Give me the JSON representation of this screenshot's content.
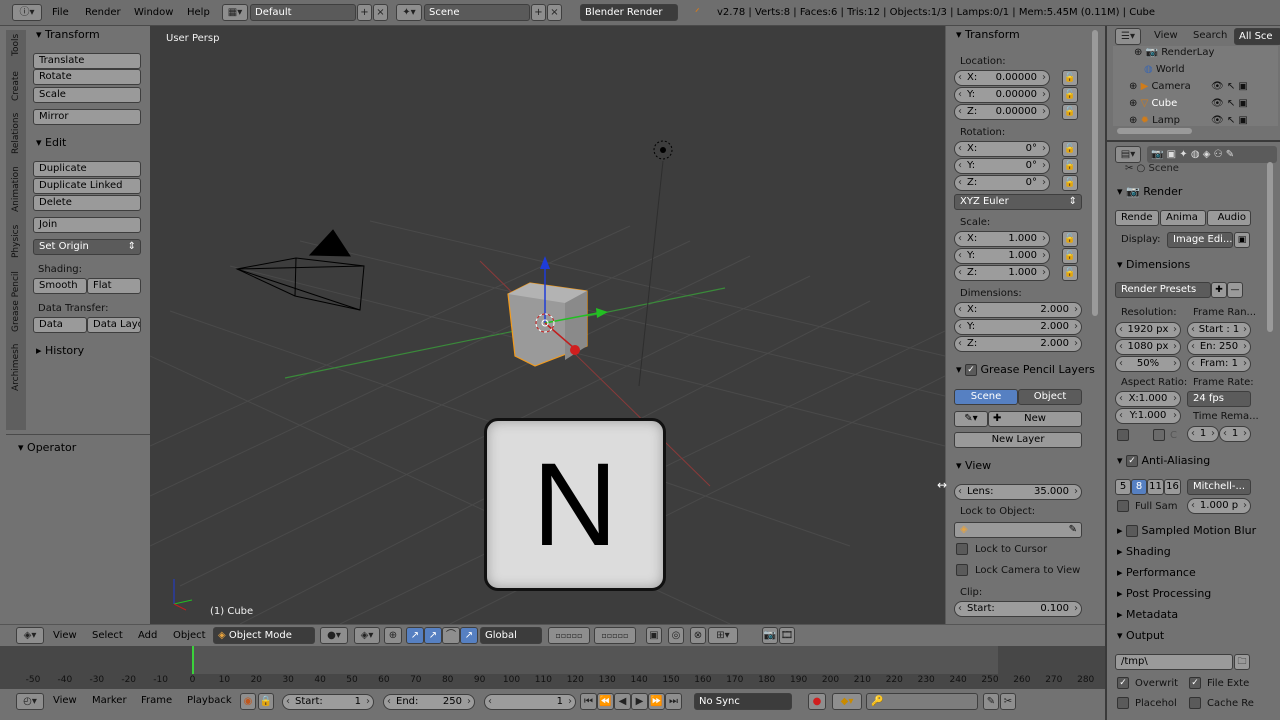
{
  "topbar": {
    "menus": [
      "File",
      "Render",
      "Window",
      "Help"
    ],
    "screen_layout": "Default",
    "scene": "Scene",
    "engine": "Blender Render",
    "stats": "v2.78 | Verts:8 | Faces:6 | Tris:12 | Objects:1/3 | Lamps:0/1 | Mem:5.45M (0.11M) | Cube"
  },
  "toolshelf": {
    "tabs": [
      "Tools",
      "Create",
      "Relations",
      "Animation",
      "Physics",
      "Grease Pencil",
      "Archimesh"
    ],
    "transform_header": "Transform",
    "transform_buttons": [
      "Translate",
      "Rotate",
      "Scale"
    ],
    "mirror": "Mirror",
    "edit_header": "Edit",
    "edit_buttons": [
      "Duplicate",
      "Duplicate Linked",
      "Delete"
    ],
    "join": "Join",
    "set_origin": "Set Origin",
    "shading_label": "Shading:",
    "smooth": "Smooth",
    "flat": "Flat",
    "data_transfer_label": "Data Transfer:",
    "data": "Data",
    "data_layout": "Data Layo",
    "history": "History",
    "operator": "Operator"
  },
  "viewport": {
    "view_name": "User Persp",
    "object_label": "(1) Cube",
    "key_overlay": "N"
  },
  "properties_n": {
    "transform_header": "Transform",
    "location_label": "Location:",
    "location": [
      {
        "k": "X:",
        "v": "0.00000"
      },
      {
        "k": "Y:",
        "v": "0.00000"
      },
      {
        "k": "Z:",
        "v": "0.00000"
      }
    ],
    "rotation_label": "Rotation:",
    "rotation": [
      {
        "k": "X:",
        "v": "0°"
      },
      {
        "k": "Y:",
        "v": "0°"
      },
      {
        "k": "Z:",
        "v": "0°"
      }
    ],
    "rotation_mode": "XYZ Euler",
    "scale_label": "Scale:",
    "scale": [
      {
        "k": "X:",
        "v": "1.000"
      },
      {
        "k": "Y:",
        "v": "1.000"
      },
      {
        "k": "Z:",
        "v": "1.000"
      }
    ],
    "dimensions_label": "Dimensions:",
    "dimensions": [
      {
        "k": "X:",
        "v": "2.000"
      },
      {
        "k": "Y:",
        "v": "2.000"
      },
      {
        "k": "Z:",
        "v": "2.000"
      }
    ],
    "gp_header": "Grease Pencil Layers",
    "gp_scene": "Scene",
    "gp_object": "Object",
    "gp_new": "New",
    "gp_new_layer": "New Layer",
    "view_header": "View",
    "lens_k": "Lens:",
    "lens_v": "35.000",
    "lock_to_object": "Lock to Object:",
    "lock_cursor": "Lock to Cursor",
    "lock_camera": "Lock Camera to View",
    "clip_label": "Clip:",
    "clip_start_k": "Start:",
    "clip_start_v": "0.100"
  },
  "outliner": {
    "view": "View",
    "search": "Search",
    "filter": "All Sce",
    "items": [
      "RenderLay",
      "World",
      "Camera",
      "Cube",
      "Lamp"
    ]
  },
  "render_props": {
    "scene_crumb": "Scene",
    "render_header": "Render",
    "render_buttons": [
      "Rende",
      "Anima",
      "Audio"
    ],
    "display_label": "Display:",
    "display_value": "Image Edi...",
    "dimensions_header": "Dimensions",
    "presets": "Render Presets",
    "resolution_label": "Resolution:",
    "frame_range_label": "Frame Ran...",
    "res_x": "1920 px",
    "res_y": "1080 px",
    "res_pct": "50%",
    "frame_start": "Start : 1",
    "frame_end": "En: 250",
    "frame_step": "Fram: 1",
    "aspect_label": "Aspect Ratio:",
    "framerate_label": "Frame Rate:",
    "aspect_x": "X:1.000",
    "aspect_y": "Y:1.000",
    "fps": "24 fps",
    "time_remap": "Time Rema...",
    "remap_a": "1",
    "remap_b": "1",
    "c_label": "C",
    "aa_header": "Anti-Aliasing",
    "aa_samples": [
      "5",
      "8",
      "11",
      "16"
    ],
    "aa_filter": "Mitchell-...",
    "full_sample": "Full Sam",
    "aa_size": "1.000 p",
    "smb": "Sampled Motion Blur",
    "shading": "Shading",
    "performance": "Performance",
    "post_processing": "Post Processing",
    "metadata": "Metadata",
    "output": "Output",
    "output_path": "/tmp\\",
    "overwrite": "Overwrit",
    "file_ext": "File Exte",
    "placeholders": "Placehol",
    "cache": "Cache Re"
  },
  "vp_header": {
    "menus": [
      "View",
      "Select",
      "Add",
      "Object"
    ],
    "mode": "Object Mode",
    "orientation": "Global"
  },
  "timeline": {
    "ticks": [
      "-50",
      "-40",
      "-30",
      "-20",
      "-10",
      "0",
      "10",
      "20",
      "30",
      "40",
      "50",
      "60",
      "70",
      "80",
      "90",
      "100",
      "110",
      "120",
      "130",
      "140",
      "150",
      "160",
      "170",
      "180",
      "190",
      "200",
      "210",
      "220",
      "230",
      "240",
      "250",
      "260",
      "270",
      "280"
    ],
    "current_frame": 0
  },
  "bottombar": {
    "menus": [
      "View",
      "Marker",
      "Frame",
      "Playback"
    ],
    "start_k": "Start:",
    "start_v": "1",
    "end_k": "End:",
    "end_v": "250",
    "current": "1",
    "sync": "No Sync"
  }
}
